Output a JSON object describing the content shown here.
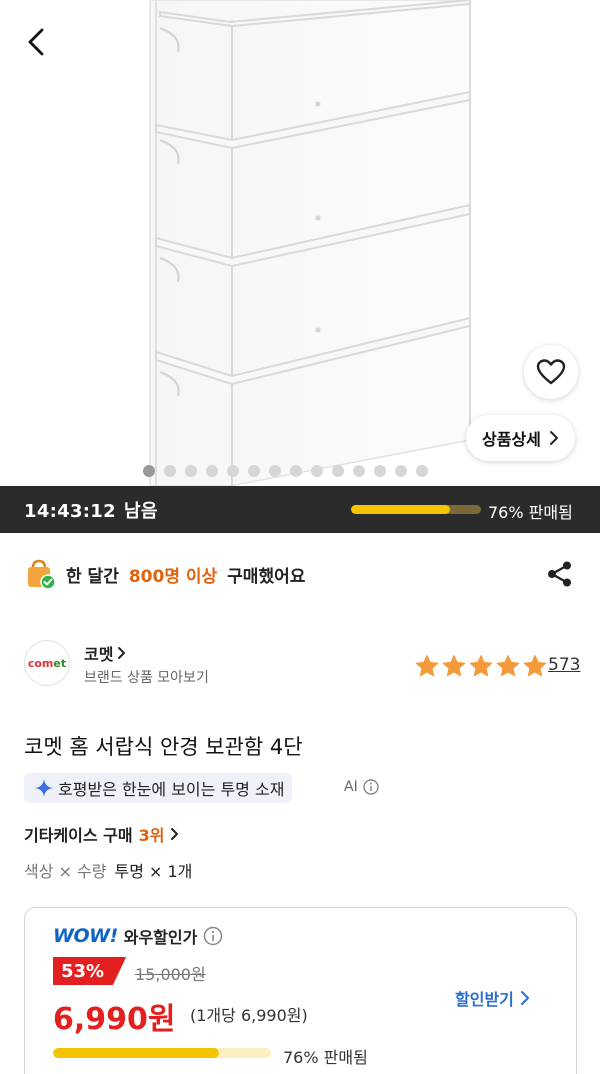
{
  "colors": {
    "accent_orange": "#e0620c",
    "sale_red": "#e41f1f",
    "link_blue": "#2a6ed2",
    "progress_yellow": "#f5c400",
    "timer_bg": "#2b2b2b"
  },
  "header": {
    "back_icon": "chevron-left-icon",
    "favorite_icon": "heart-icon",
    "detail_button_label": "상품상세",
    "image_count": 14,
    "active_image_index": 0
  },
  "timer": {
    "time_text": "14:43:12",
    "remaining_label": "남음",
    "sold_fraction": 0.76,
    "sold_label": "76% 판매됨"
  },
  "notice": {
    "icon": "shopping-bag-check-icon",
    "prefix": "한 달간",
    "highlight": "800명 이상",
    "suffix": "구매했어요",
    "share_icon": "share-icon"
  },
  "brand": {
    "logo_text_1": "com",
    "logo_text_2": "et",
    "name": "코멧",
    "sub_link": "브랜드 상품 모아보기",
    "rating": 5,
    "review_count": "573"
  },
  "product": {
    "title": "코멧 홈 서랍식 안경 보관함 4단",
    "ai_summary": "호평받은 한눈에 보이는 투명 소재",
    "ai_label": "AI",
    "rank_category": "기타케이스 구매",
    "rank_value": "3위",
    "option_label": "색상 × 수량",
    "option_value": "투명 × 1개"
  },
  "price": {
    "wow_logo": "WOW!",
    "wow_label": "와우할인가",
    "discount_rate": "53%",
    "original_price": "15,000원",
    "sale_price": "6,990원",
    "unit_price": "(1개당 6,990원)",
    "discount_link": "할인받기",
    "sold_fraction": 0.76,
    "sold_label": "76% 판매됨"
  }
}
